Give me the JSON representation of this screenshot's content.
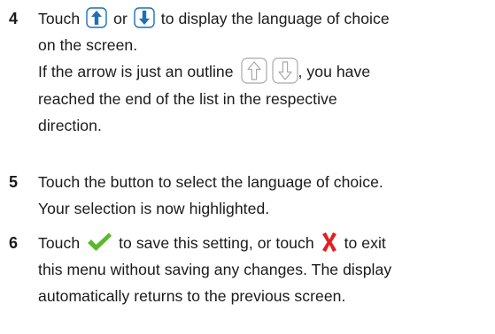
{
  "steps": [
    {
      "number": "4",
      "text_1a": "Touch",
      "text_1b": "or",
      "text_1c": "to display the language of choice",
      "text_2": "on the screen.",
      "text_3a": "If the arrow is just an outline",
      "text_3b": ", you have",
      "text_4": "reached the end of the list in the respective",
      "text_5": "direction.",
      "icons": [
        "arrow-up-filled-icon",
        "arrow-down-filled-icon",
        "arrow-up-outline-icon",
        "arrow-down-outline-icon"
      ]
    },
    {
      "number": "5",
      "text_1": "Touch the button to select the language of choice.",
      "text_2": "Your selection is now highlighted."
    },
    {
      "number": "6",
      "text_1a": "Touch",
      "text_1b": "to save this setting, or touch",
      "text_1c": "to exit",
      "text_2": "this menu without saving any changes. The display",
      "text_3": "automatically returns to the previous screen.",
      "icons": [
        "checkmark-icon",
        "cross-icon"
      ]
    }
  ],
  "colors": {
    "text": "#1a1a1a",
    "arrow_blue": "#1f6fb5",
    "outline_gray": "#a9a9a9",
    "check_green": "#59b92b",
    "cross_red": "#e02020"
  }
}
